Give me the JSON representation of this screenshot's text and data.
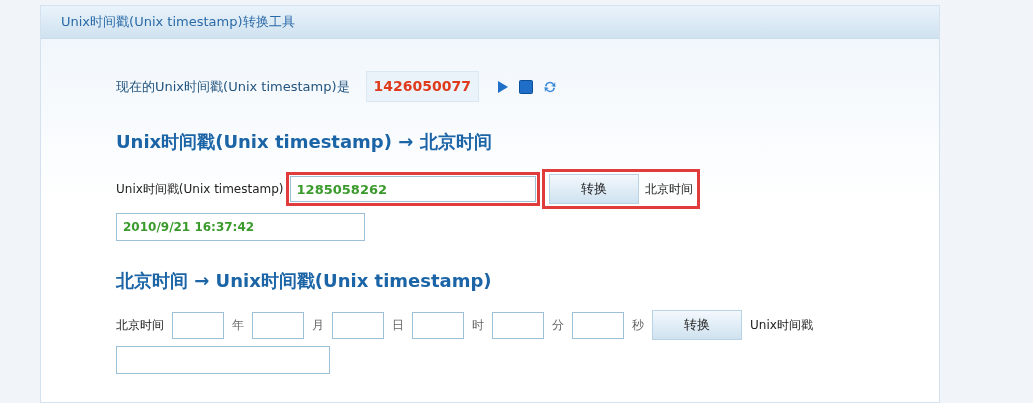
{
  "panel": {
    "title": "Unix时间戳(Unix timestamp)转换工具"
  },
  "current": {
    "label": "现在的Unix时间戳(Unix timestamp)是",
    "value": "1426050077"
  },
  "to_beijing": {
    "heading": "Unix时间戳(Unix timestamp) → 北京时间",
    "field_label": "Unix时间戳(Unix timestamp)",
    "value": "1285058262",
    "field_highlighted": true,
    "button": "转换",
    "button_highlighted": true,
    "result_label": "北京时间",
    "result": "2010/9/21 16:37:42"
  },
  "to_unix": {
    "heading": "北京时间 → Unix时间戳(Unix timestamp)",
    "field_label": "北京时间",
    "parts": [
      {
        "unit": "年"
      },
      {
        "unit": "月"
      },
      {
        "unit": "日"
      },
      {
        "unit": "时"
      },
      {
        "unit": "分"
      },
      {
        "unit": "秒"
      }
    ],
    "button": "转换",
    "result_label": "Unix时间戳"
  }
}
